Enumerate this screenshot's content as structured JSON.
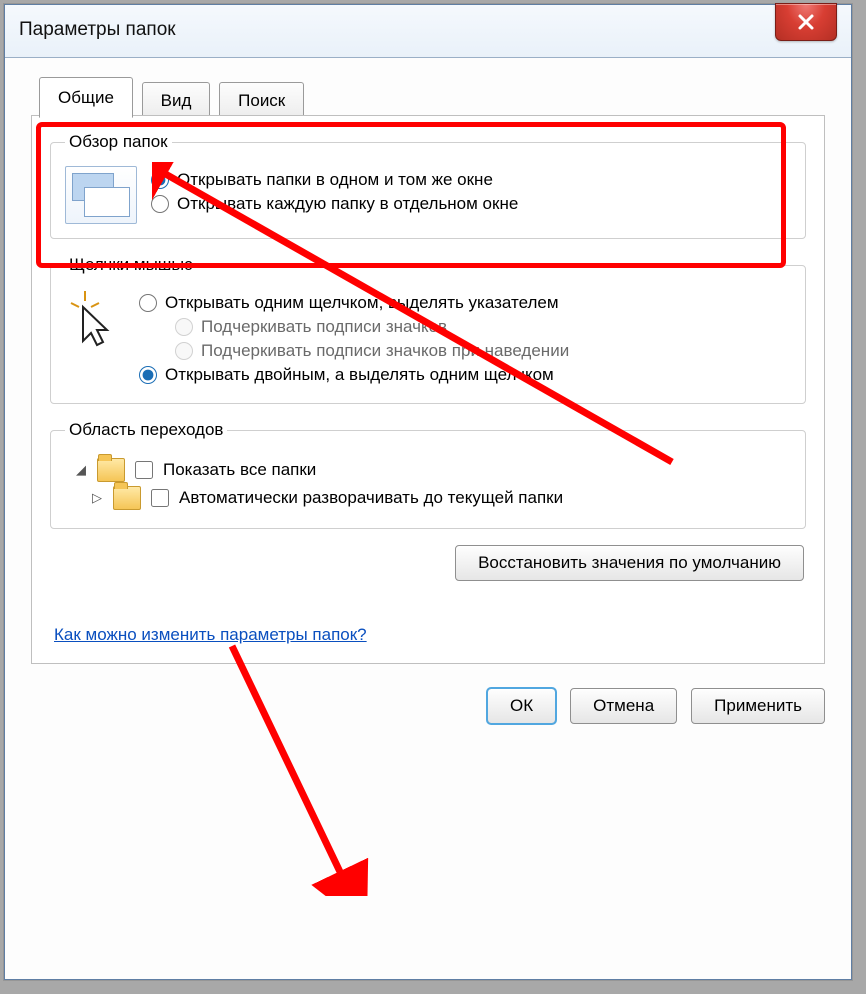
{
  "window": {
    "title": "Параметры папок"
  },
  "tabs": {
    "general": "Общие",
    "view": "Вид",
    "search": "Поиск"
  },
  "browse": {
    "legend": "Обзор папок",
    "same_window": "Открывать папки в одном и том же окне",
    "separate_window": "Открывать каждую папку в отдельном окне"
  },
  "clicks": {
    "legend": "Щелчки мышью",
    "single": "Открывать одним щелчком, выделять указателем",
    "underline1": "Подчеркивать подписи значков",
    "underline2": "Подчеркивать подписи значков при наведении",
    "double": "Открывать двойным, а выделять одним щелчком"
  },
  "navpane": {
    "legend": "Область переходов",
    "show_all": "Показать все папки",
    "auto_expand": "Автоматически разворачивать до текущей папки"
  },
  "restore_defaults": "Восстановить значения по умолчанию",
  "help_link": "Как можно изменить параметры папок?",
  "buttons": {
    "ok": "ОК",
    "cancel": "Отмена",
    "apply": "Применить"
  }
}
